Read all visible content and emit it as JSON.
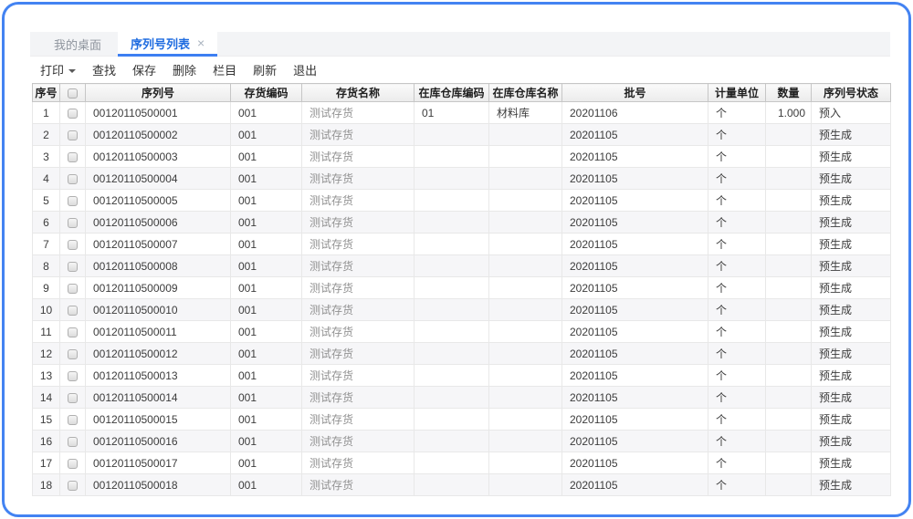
{
  "colors": {
    "window_border_blue": "#4383f2",
    "active_tab_blue": "#1f6ce0",
    "tab_underline_blue": "#3d7ff2",
    "header_bg_grey": "#ededed",
    "zebra_row_grey": "#f6f6f8"
  },
  "tabs": [
    {
      "label": "我的桌面",
      "active": false
    },
    {
      "label": "序列号列表",
      "active": true,
      "close_icon": "×"
    }
  ],
  "toolbar": {
    "buttons": [
      {
        "name": "print",
        "label": "打印",
        "has_dropdown": true
      },
      {
        "name": "find",
        "label": "查找"
      },
      {
        "name": "save",
        "label": "保存"
      },
      {
        "name": "delete",
        "label": "删除"
      },
      {
        "name": "columns",
        "label": "栏目"
      },
      {
        "name": "refresh",
        "label": "刷新"
      },
      {
        "name": "exit",
        "label": "退出"
      }
    ]
  },
  "table": {
    "columns": [
      {
        "key": "no",
        "label": "序号"
      },
      {
        "key": "check",
        "label": ""
      },
      {
        "key": "serial",
        "label": "序列号"
      },
      {
        "key": "inv_code",
        "label": "存货编码"
      },
      {
        "key": "inv_name",
        "label": "存货名称"
      },
      {
        "key": "wh_code",
        "label": "在库仓库编码"
      },
      {
        "key": "wh_name",
        "label": "在库仓库名称"
      },
      {
        "key": "batch",
        "label": "批号"
      },
      {
        "key": "unit",
        "label": "计量单位"
      },
      {
        "key": "qty",
        "label": "数量"
      },
      {
        "key": "status",
        "label": "序列号状态"
      }
    ],
    "rows": [
      {
        "no": "1",
        "serial": "00120110500001",
        "inv_code": "001",
        "inv_name": "测试存货",
        "wh_code": "01",
        "wh_name": "材料库",
        "batch": "20201106",
        "unit": "个",
        "qty": "1.000",
        "status": "预入"
      },
      {
        "no": "2",
        "serial": "00120110500002",
        "inv_code": "001",
        "inv_name": "测试存货",
        "wh_code": "",
        "wh_name": "",
        "batch": "20201105",
        "unit": "个",
        "qty": "",
        "status": "预生成"
      },
      {
        "no": "3",
        "serial": "00120110500003",
        "inv_code": "001",
        "inv_name": "测试存货",
        "wh_code": "",
        "wh_name": "",
        "batch": "20201105",
        "unit": "个",
        "qty": "",
        "status": "预生成"
      },
      {
        "no": "4",
        "serial": "00120110500004",
        "inv_code": "001",
        "inv_name": "测试存货",
        "wh_code": "",
        "wh_name": "",
        "batch": "20201105",
        "unit": "个",
        "qty": "",
        "status": "预生成"
      },
      {
        "no": "5",
        "serial": "00120110500005",
        "inv_code": "001",
        "inv_name": "测试存货",
        "wh_code": "",
        "wh_name": "",
        "batch": "20201105",
        "unit": "个",
        "qty": "",
        "status": "预生成"
      },
      {
        "no": "6",
        "serial": "00120110500006",
        "inv_code": "001",
        "inv_name": "测试存货",
        "wh_code": "",
        "wh_name": "",
        "batch": "20201105",
        "unit": "个",
        "qty": "",
        "status": "预生成"
      },
      {
        "no": "7",
        "serial": "00120110500007",
        "inv_code": "001",
        "inv_name": "测试存货",
        "wh_code": "",
        "wh_name": "",
        "batch": "20201105",
        "unit": "个",
        "qty": "",
        "status": "预生成"
      },
      {
        "no": "8",
        "serial": "00120110500008",
        "inv_code": "001",
        "inv_name": "测试存货",
        "wh_code": "",
        "wh_name": "",
        "batch": "20201105",
        "unit": "个",
        "qty": "",
        "status": "预生成"
      },
      {
        "no": "9",
        "serial": "00120110500009",
        "inv_code": "001",
        "inv_name": "测试存货",
        "wh_code": "",
        "wh_name": "",
        "batch": "20201105",
        "unit": "个",
        "qty": "",
        "status": "预生成"
      },
      {
        "no": "10",
        "serial": "00120110500010",
        "inv_code": "001",
        "inv_name": "测试存货",
        "wh_code": "",
        "wh_name": "",
        "batch": "20201105",
        "unit": "个",
        "qty": "",
        "status": "预生成"
      },
      {
        "no": "11",
        "serial": "00120110500011",
        "inv_code": "001",
        "inv_name": "测试存货",
        "wh_code": "",
        "wh_name": "",
        "batch": "20201105",
        "unit": "个",
        "qty": "",
        "status": "预生成"
      },
      {
        "no": "12",
        "serial": "00120110500012",
        "inv_code": "001",
        "inv_name": "测试存货",
        "wh_code": "",
        "wh_name": "",
        "batch": "20201105",
        "unit": "个",
        "qty": "",
        "status": "预生成"
      },
      {
        "no": "13",
        "serial": "00120110500013",
        "inv_code": "001",
        "inv_name": "测试存货",
        "wh_code": "",
        "wh_name": "",
        "batch": "20201105",
        "unit": "个",
        "qty": "",
        "status": "预生成"
      },
      {
        "no": "14",
        "serial": "00120110500014",
        "inv_code": "001",
        "inv_name": "测试存货",
        "wh_code": "",
        "wh_name": "",
        "batch": "20201105",
        "unit": "个",
        "qty": "",
        "status": "预生成"
      },
      {
        "no": "15",
        "serial": "00120110500015",
        "inv_code": "001",
        "inv_name": "测试存货",
        "wh_code": "",
        "wh_name": "",
        "batch": "20201105",
        "unit": "个",
        "qty": "",
        "status": "预生成"
      },
      {
        "no": "16",
        "serial": "00120110500016",
        "inv_code": "001",
        "inv_name": "测试存货",
        "wh_code": "",
        "wh_name": "",
        "batch": "20201105",
        "unit": "个",
        "qty": "",
        "status": "预生成"
      },
      {
        "no": "17",
        "serial": "00120110500017",
        "inv_code": "001",
        "inv_name": "测试存货",
        "wh_code": "",
        "wh_name": "",
        "batch": "20201105",
        "unit": "个",
        "qty": "",
        "status": "预生成"
      },
      {
        "no": "18",
        "serial": "00120110500018",
        "inv_code": "001",
        "inv_name": "测试存货",
        "wh_code": "",
        "wh_name": "",
        "batch": "20201105",
        "unit": "个",
        "qty": "",
        "status": "预生成"
      }
    ]
  }
}
